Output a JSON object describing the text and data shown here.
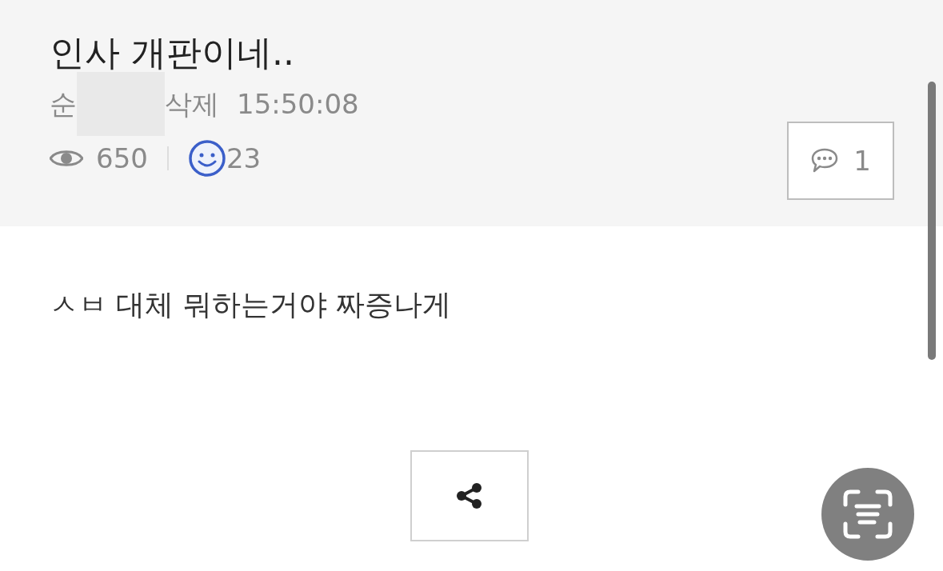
{
  "post": {
    "title": "인사 개판이네..",
    "author_start": "순",
    "author_end": "삭제",
    "time": "15:50:08",
    "views": "650",
    "likes": "23",
    "comments": "1",
    "body": "ㅅㅂ 대체 뭐하는거야 짜증나게"
  }
}
